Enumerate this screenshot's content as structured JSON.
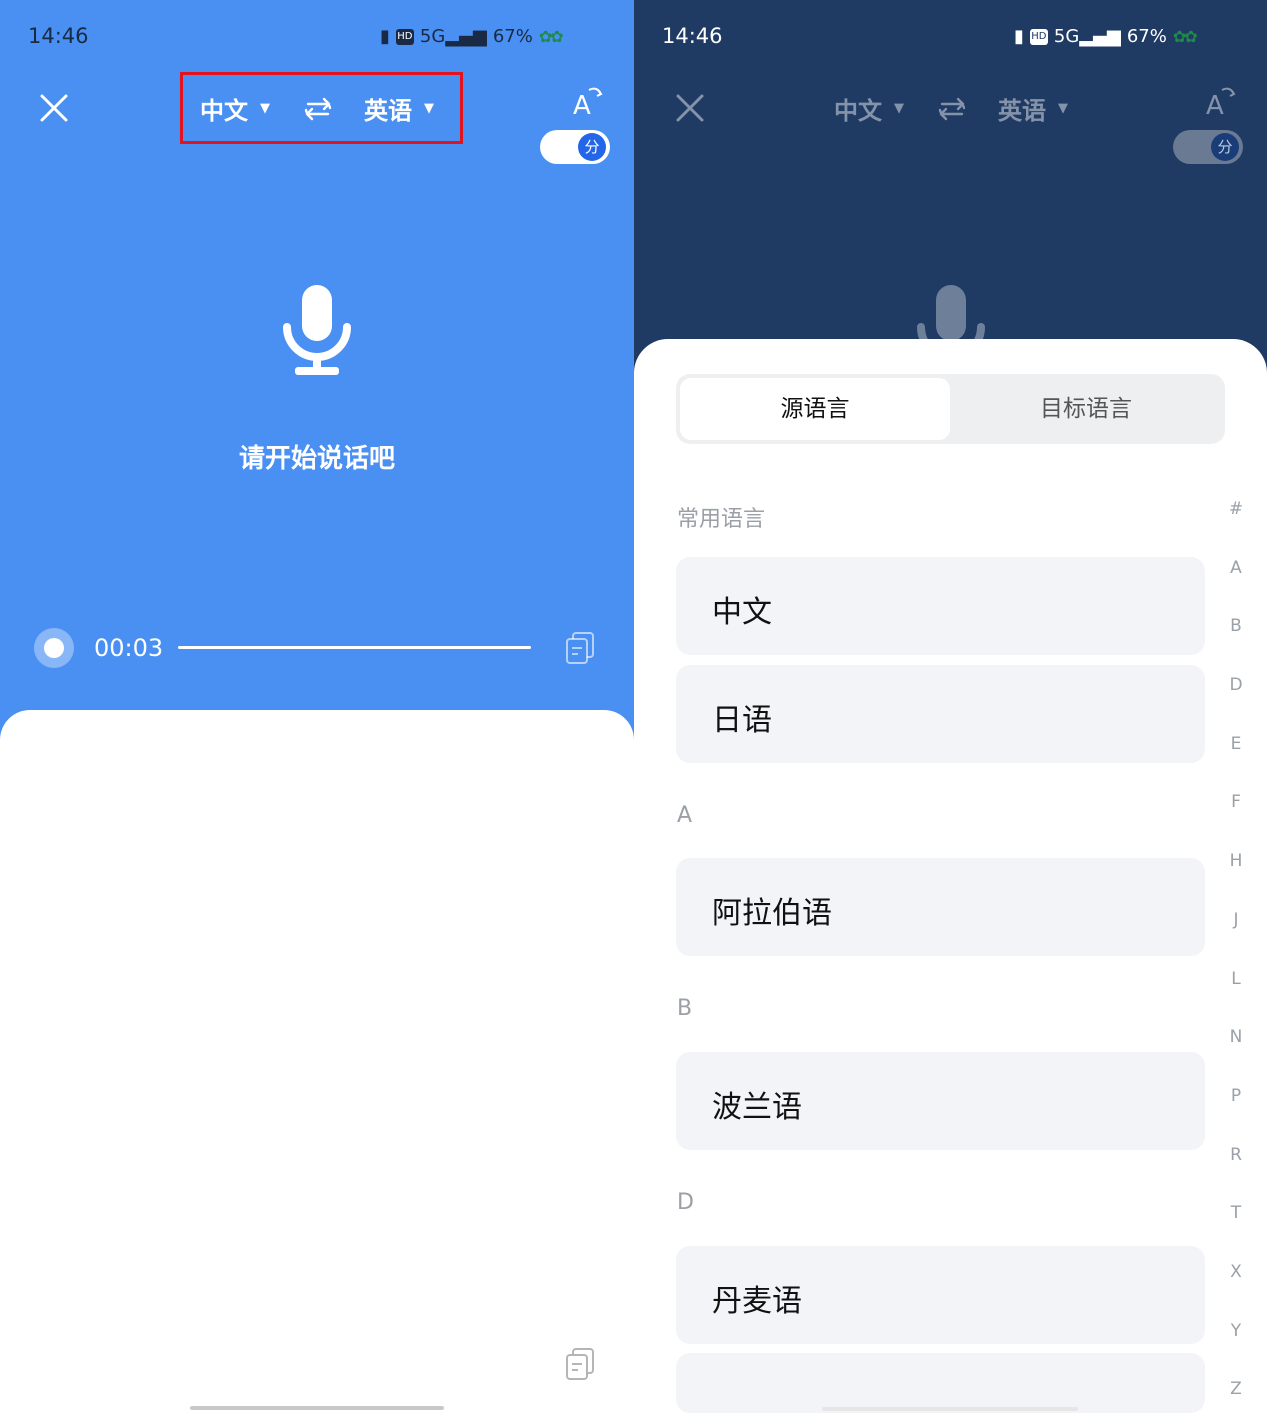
{
  "status_bar": {
    "time": "14:46",
    "network": "5G",
    "battery": "67%"
  },
  "header": {
    "source_lang": "中文",
    "target_lang": "英语",
    "toggle_label": "分"
  },
  "left": {
    "prompt": "请开始说话吧",
    "timer": "00:03"
  },
  "right": {
    "tabs": [
      "源语言",
      "目标语言"
    ],
    "sections": {
      "common": "常用语言",
      "a": "A",
      "b": "B",
      "d": "D"
    },
    "languages": {
      "chinese": "中文",
      "japanese": "日语",
      "arabic": "阿拉伯语",
      "polish": "波兰语",
      "danish": "丹麦语"
    },
    "alphabet_index": [
      "#",
      "A",
      "B",
      "D",
      "E",
      "F",
      "H",
      "J",
      "L",
      "N",
      "P",
      "R",
      "T",
      "X",
      "Y",
      "Z"
    ]
  },
  "colors": {
    "left_bg": "#4a90f2",
    "right_bg": "#1f3a63",
    "highlight": "#e0131e",
    "toggle_knob": "#2366e8"
  }
}
